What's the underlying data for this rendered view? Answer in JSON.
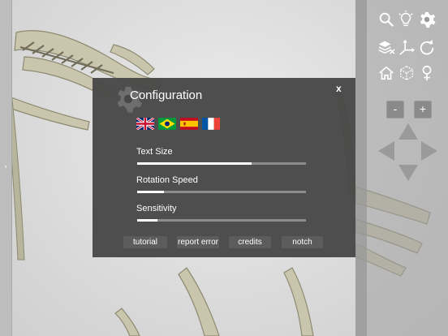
{
  "app": {
    "left_handle": "›"
  },
  "dialog": {
    "title": "Configuration",
    "close": "x",
    "flags": [
      "uk-flag",
      "brazil-flag",
      "spain-flag",
      "france-flag"
    ],
    "settings": [
      {
        "label": "Text Size",
        "value": 0.68
      },
      {
        "label": "Rotation Speed",
        "value": 0.16
      },
      {
        "label": "Sensitivity",
        "value": 0.12
      }
    ],
    "buttons": {
      "tutorial": "tutorial",
      "report_error": "report error",
      "credits": "credits",
      "notch": "notch"
    }
  },
  "toolbar": {
    "icons": [
      "search-icon",
      "lightbulb-icon",
      "gear-icon",
      "layers-icon",
      "axes-icon",
      "rotate-icon",
      "home-icon",
      "cube-icon",
      "female-icon"
    ],
    "zoom_out": "-",
    "zoom_in": "+"
  },
  "colors": {
    "dialog_bg": "#484848",
    "slider_fill": "#ffffff",
    "slider_track": "#8c8c8c"
  }
}
